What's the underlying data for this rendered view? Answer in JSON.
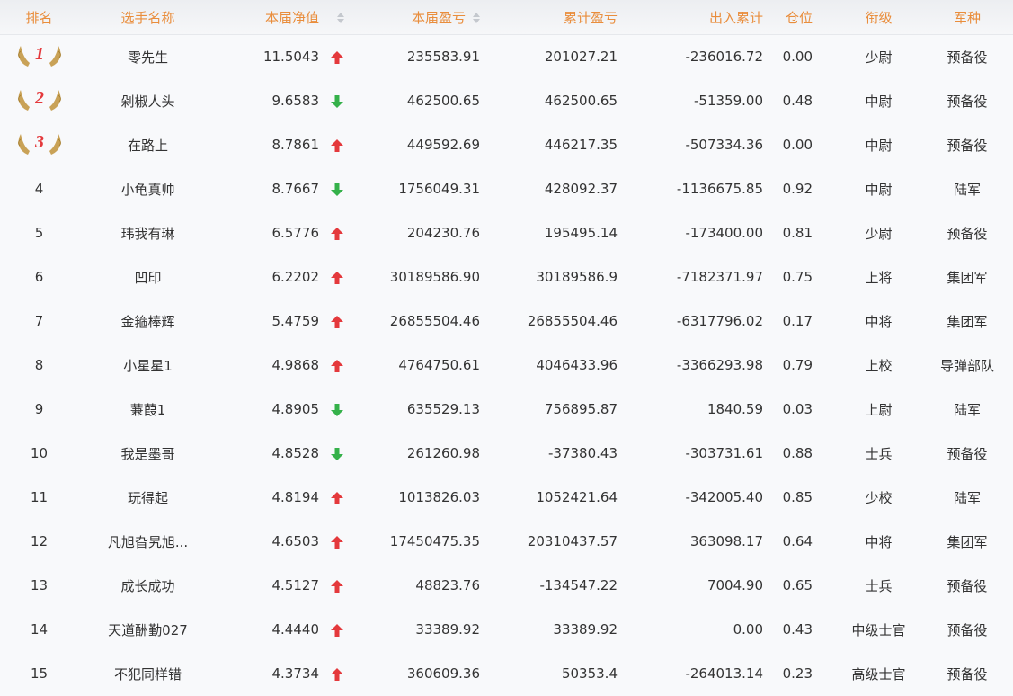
{
  "columns": {
    "rank": "排名",
    "name": "选手名称",
    "nav": "本届净值",
    "current_pl": "本届盈亏",
    "cumulative_pl": "累计盈亏",
    "inout": "出入累计",
    "position": "仓位",
    "military_rank": "衔级",
    "branch": "军种"
  },
  "colors": {
    "header_text": "#e98d3c",
    "up_arrow": "#e4393c",
    "down_arrow": "#35b14a",
    "medal": "#c9a257",
    "medal_number": "#e4393c"
  },
  "rows": [
    {
      "rank": "1",
      "medal": true,
      "name": "零先生",
      "nav": "11.5043",
      "trend": "up",
      "current_pl": "235583.91",
      "cumulative_pl": "201027.21",
      "inout": "-236016.72",
      "position": "0.00",
      "military_rank": "少尉",
      "branch": "预备役"
    },
    {
      "rank": "2",
      "medal": true,
      "name": "剁椒人头",
      "nav": "9.6583",
      "trend": "down",
      "current_pl": "462500.65",
      "cumulative_pl": "462500.65",
      "inout": "-51359.00",
      "position": "0.48",
      "military_rank": "中尉",
      "branch": "预备役"
    },
    {
      "rank": "3",
      "medal": true,
      "name": "在路上",
      "nav": "8.7861",
      "trend": "up",
      "current_pl": "449592.69",
      "cumulative_pl": "446217.35",
      "inout": "-507334.36",
      "position": "0.00",
      "military_rank": "中尉",
      "branch": "预备役"
    },
    {
      "rank": "4",
      "medal": false,
      "name": "小龟真帅",
      "nav": "8.7667",
      "trend": "down",
      "current_pl": "1756049.31",
      "cumulative_pl": "428092.37",
      "inout": "-1136675.85",
      "position": "0.92",
      "military_rank": "中尉",
      "branch": "陆军"
    },
    {
      "rank": "5",
      "medal": false,
      "name": "玮我有琳",
      "nav": "6.5776",
      "trend": "up",
      "current_pl": "204230.76",
      "cumulative_pl": "195495.14",
      "inout": "-173400.00",
      "position": "0.81",
      "military_rank": "少尉",
      "branch": "预备役"
    },
    {
      "rank": "6",
      "medal": false,
      "name": "凹印",
      "nav": "6.2202",
      "trend": "up",
      "current_pl": "30189586.90",
      "cumulative_pl": "30189586.9",
      "inout": "-7182371.97",
      "position": "0.75",
      "military_rank": "上将",
      "branch": "集团军"
    },
    {
      "rank": "7",
      "medal": false,
      "name": "金箍棒辉",
      "nav": "5.4759",
      "trend": "up",
      "current_pl": "26855504.46",
      "cumulative_pl": "26855504.46",
      "inout": "-6317796.02",
      "position": "0.17",
      "military_rank": "中将",
      "branch": "集团军"
    },
    {
      "rank": "8",
      "medal": false,
      "name": "小星星1",
      "nav": "4.9868",
      "trend": "up",
      "current_pl": "4764750.61",
      "cumulative_pl": "4046433.96",
      "inout": "-3366293.98",
      "position": "0.79",
      "military_rank": "上校",
      "branch": "导弹部队"
    },
    {
      "rank": "9",
      "medal": false,
      "name": "蒹葭1",
      "nav": "4.8905",
      "trend": "down",
      "current_pl": "635529.13",
      "cumulative_pl": "756895.87",
      "inout": "1840.59",
      "position": "0.03",
      "military_rank": "上尉",
      "branch": "陆军"
    },
    {
      "rank": "10",
      "medal": false,
      "name": "我是墨哥",
      "nav": "4.8528",
      "trend": "down",
      "current_pl": "261260.98",
      "cumulative_pl": "-37380.43",
      "inout": "-303731.61",
      "position": "0.88",
      "military_rank": "士兵",
      "branch": "预备役"
    },
    {
      "rank": "11",
      "medal": false,
      "name": "玩得起",
      "nav": "4.8194",
      "trend": "up",
      "current_pl": "1013826.03",
      "cumulative_pl": "1052421.64",
      "inout": "-342005.40",
      "position": "0.85",
      "military_rank": "少校",
      "branch": "陆军"
    },
    {
      "rank": "12",
      "medal": false,
      "name": "凡旭旮旯旭...",
      "nav": "4.6503",
      "trend": "up",
      "current_pl": "17450475.35",
      "cumulative_pl": "20310437.57",
      "inout": "363098.17",
      "position": "0.64",
      "military_rank": "中将",
      "branch": "集团军"
    },
    {
      "rank": "13",
      "medal": false,
      "name": "成长成功",
      "nav": "4.5127",
      "trend": "up",
      "current_pl": "48823.76",
      "cumulative_pl": "-134547.22",
      "inout": "7004.90",
      "position": "0.65",
      "military_rank": "士兵",
      "branch": "预备役"
    },
    {
      "rank": "14",
      "medal": false,
      "name": "天道酬勤027",
      "nav": "4.4440",
      "trend": "up",
      "current_pl": "33389.92",
      "cumulative_pl": "33389.92",
      "inout": "0.00",
      "position": "0.43",
      "military_rank": "中级士官",
      "branch": "预备役"
    },
    {
      "rank": "15",
      "medal": false,
      "name": "不犯同样错",
      "nav": "4.3734",
      "trend": "up",
      "current_pl": "360609.36",
      "cumulative_pl": "50353.4",
      "inout": "-264013.14",
      "position": "0.23",
      "military_rank": "高级士官",
      "branch": "预备役"
    }
  ]
}
